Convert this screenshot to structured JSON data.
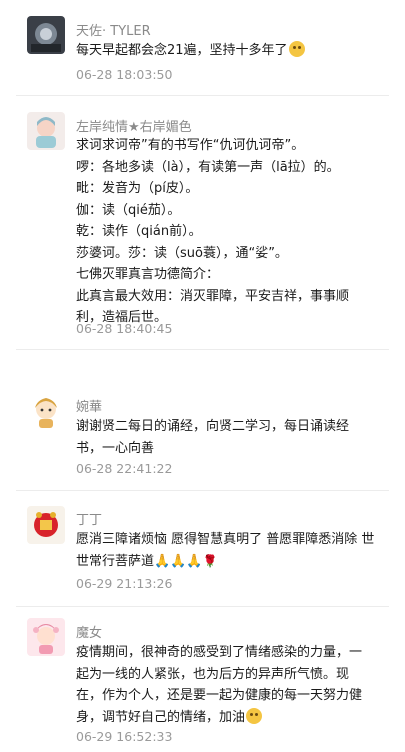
{
  "comments": [
    {
      "name": "天佐· TYLER",
      "lines": [
        "每天早起都会念21遍，坚持十多年了"
      ],
      "time": "06-28 18:03:50"
    },
    {
      "name": "左岸纯情★右岸媚色",
      "lines": [
        "求诃求诃帝”有的书写作“仇诃仇诃帝”。",
        "啰：各地多读（là），有读第一声（lā拉）的。",
        "毗：发音为（pí皮）。",
        "伽：读（qié茄）。",
        "乾：读作（qián前）。",
        "莎婆诃。莎：读（suō蓑），通“娑”。",
        "七佛灭罪真言功德简介：",
        "此真言最大效用：消灭罪障，平安吉祥，事事顺",
        "利，造福后世。"
      ],
      "time": "06-28 18:40:45"
    },
    {
      "name": "婉華",
      "lines": [
        "谢谢贤二每日的诵经，向贤二学习，每日诵读经",
        "书，一心向善"
      ],
      "time": "06-28 22:41:22"
    },
    {
      "name": "丁丁",
      "lines": [
        "愿消三障诸烦恼 愿得智慧真明了 普愿罪障悉消除 世",
        "世常行菩萨道"
      ],
      "time": "06-29 21:13:26"
    },
    {
      "name": "魔女",
      "lines": [
        "疫情期间，很神奇的感受到了情绪感染的力量，一",
        "起为一线的人紧张，也为后方的异声所气愤。现",
        "在，作为个人，还是要一起为健康的每一天努力健",
        "身，调节好自己的情绪，加油"
      ],
      "time": "06-29 16:52:33"
    }
  ],
  "icons": {
    "emoji_face": "emoji-face-icon",
    "praying_hands": "praying-hands-icon",
    "rose": "rose-icon"
  }
}
